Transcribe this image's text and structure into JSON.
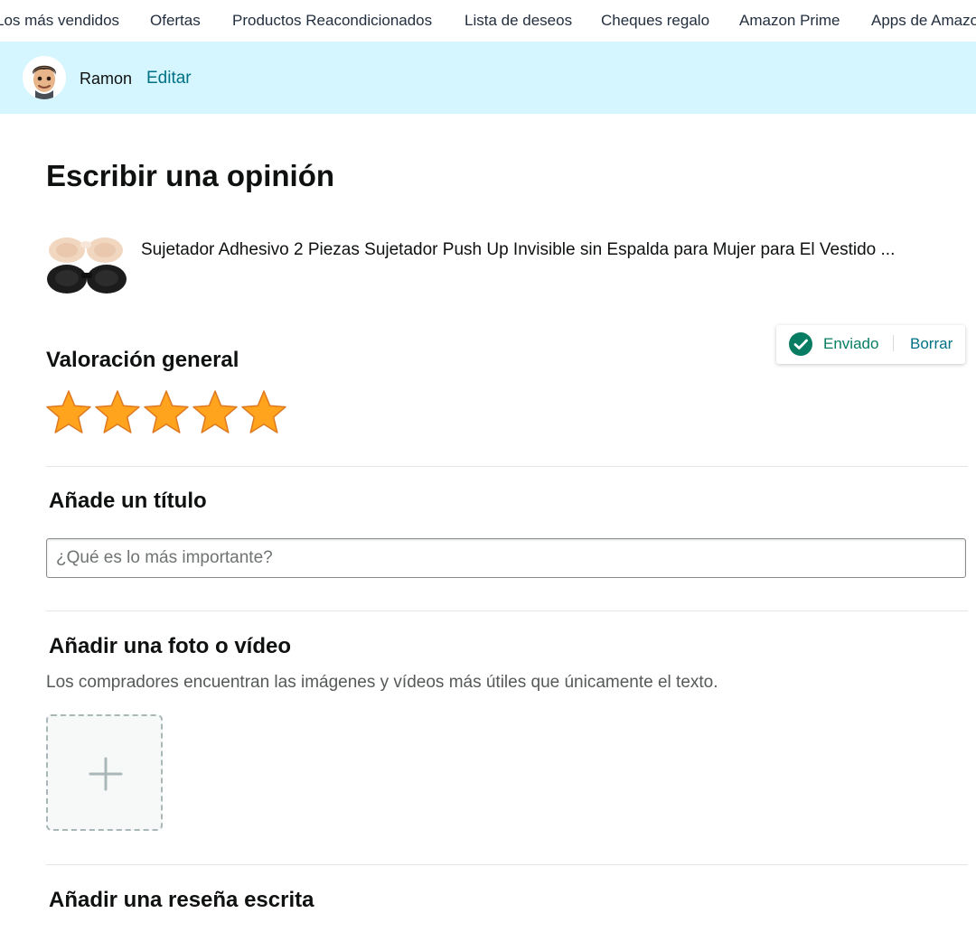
{
  "nav": {
    "items": [
      "Los más vendidos",
      "Ofertas",
      "Productos Reacondicionados",
      "Lista de deseos",
      "Cheques regalo",
      "Amazon Prime",
      "Apps de Amazon"
    ]
  },
  "profile": {
    "name": "Ramon",
    "edit_label": "Editar"
  },
  "page": {
    "title": "Escribir una opinión"
  },
  "product": {
    "name": "Sujetador Adhesivo 2 Piezas Sujetador Push Up Invisible sin Espalda para Mujer para El Vestido ..."
  },
  "rating": {
    "heading": "Valoración general",
    "value": 5,
    "max": 5,
    "status": {
      "text": "Enviado",
      "delete_label": "Borrar"
    }
  },
  "title_section": {
    "heading": "Añade un título",
    "placeholder": "¿Qué es lo más importante?",
    "value": ""
  },
  "media_section": {
    "heading": "Añadir una foto o vídeo",
    "description": "Los compradores encuentran las imágenes y vídeos más útiles que únicamente el texto."
  },
  "written_section": {
    "heading": "Añadir una reseña escrita"
  },
  "colors": {
    "link": "#007185",
    "profile_bar": "#d6f6ff",
    "star": "#ffa41c",
    "success": "#067d62"
  }
}
